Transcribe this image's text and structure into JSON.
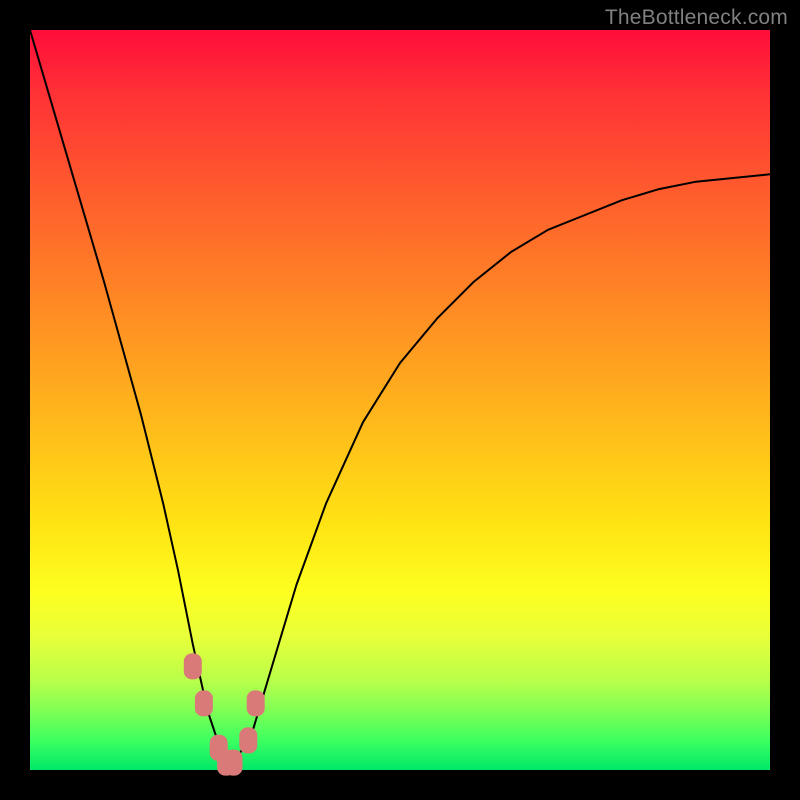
{
  "watermark": "TheBottleneck.com",
  "chart_data": {
    "type": "line",
    "title": "",
    "xlabel": "",
    "ylabel": "",
    "xlim": [
      0,
      100
    ],
    "ylim": [
      0,
      100
    ],
    "background_gradient": {
      "top_color": "#ff0d3a",
      "bottom_color": "#00e868",
      "meaning": "top=red=high bottleneck, bottom=green=no bottleneck"
    },
    "series": [
      {
        "name": "bottleneck-curve",
        "color": "#000000",
        "x": [
          0,
          5,
          10,
          15,
          18,
          20,
          22,
          24,
          26,
          27,
          30,
          33,
          36,
          40,
          45,
          50,
          55,
          60,
          65,
          70,
          75,
          80,
          85,
          90,
          95,
          100
        ],
        "y": [
          100,
          83,
          66,
          48,
          36,
          27,
          17,
          8,
          2,
          0,
          5,
          15,
          25,
          36,
          47,
          55,
          61,
          66,
          70,
          73,
          75,
          77,
          78.5,
          79.5,
          80,
          80.5
        ]
      },
      {
        "name": "highlight-markers",
        "color": "#d97a78",
        "type": "scatter",
        "x": [
          22,
          23.5,
          25.5,
          26.5,
          27.5,
          29.5,
          30.5
        ],
        "y": [
          14,
          9,
          3,
          1,
          1,
          4,
          9
        ]
      }
    ],
    "optimal_x": 27
  }
}
